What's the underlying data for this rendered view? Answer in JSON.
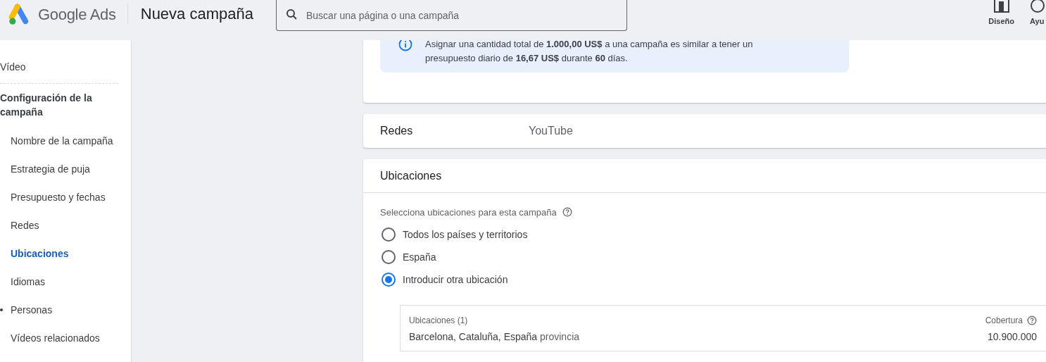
{
  "header": {
    "product": "Google Ads",
    "title": "Nueva campaña",
    "search": {
      "placeholder": "Buscar una página o una campaña"
    },
    "actions": [
      {
        "kind": "layout",
        "label": "Diseño"
      },
      {
        "kind": "help",
        "label": "Ayu"
      }
    ]
  },
  "sidebar": {
    "items": [
      {
        "kind": "item",
        "label": "Vídeo",
        "selected": false,
        "dot": false
      },
      {
        "kind": "divider"
      },
      {
        "kind": "section",
        "label": "Configuración de la campaña"
      },
      {
        "kind": "sub",
        "label": "Nombre de la campaña",
        "selected": false,
        "dot": false
      },
      {
        "kind": "sub",
        "label": "Estrategia de puja",
        "selected": false,
        "dot": false
      },
      {
        "kind": "sub",
        "label": "Presupuesto y fechas",
        "selected": false,
        "dot": false
      },
      {
        "kind": "sub",
        "label": "Redes",
        "selected": false,
        "dot": false
      },
      {
        "kind": "sub",
        "label": "Ubicaciones",
        "selected": true,
        "dot": false
      },
      {
        "kind": "sub",
        "label": "Idiomas",
        "selected": false,
        "dot": false
      },
      {
        "kind": "sub",
        "label": "Personas",
        "selected": false,
        "dot": true
      },
      {
        "kind": "sub",
        "label": "Vídeos relacionados",
        "selected": false,
        "dot": false
      }
    ]
  },
  "info": {
    "text": "Asignar una cantidad total de **1.000,00 US$** a una campaña es similar a tener un presupuesto diario de **16,67 US$** durante **60** días."
  },
  "networks": {
    "label": "Redes",
    "value": "YouTube"
  },
  "locations": {
    "title": "Ubicaciones",
    "prompt": "Selecciona ubicaciones para esta campaña",
    "options": [
      {
        "label": "Todos los países y territorios",
        "selected": false
      },
      {
        "label": "España",
        "selected": false
      },
      {
        "label": "Introducir otra ubicación",
        "selected": true
      }
    ],
    "table": {
      "heading": "Ubicaciones (1)",
      "coverage_heading": "Cobertura",
      "rows": [
        {
          "place": "Barcelona, Cataluña, España",
          "type": "provincia",
          "coverage": "10.900.000"
        }
      ]
    }
  }
}
